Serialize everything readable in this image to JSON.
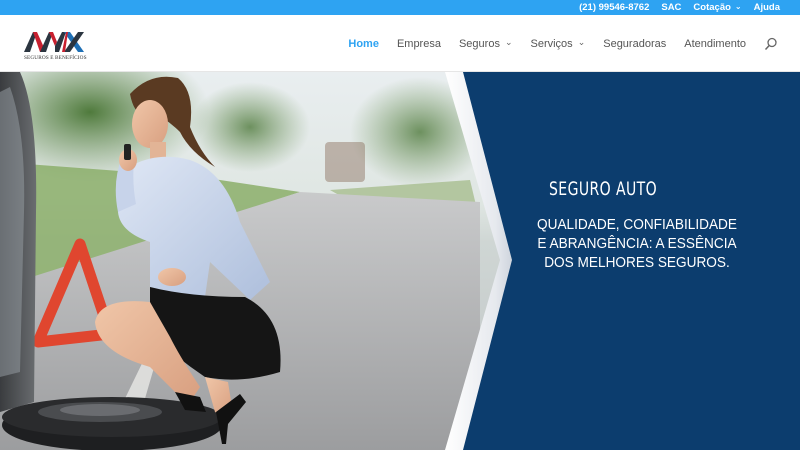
{
  "topbar": {
    "phone": "(21) 99546-8762",
    "sac": "SAC",
    "cotacao": "Cotação",
    "ajuda": "Ajuda"
  },
  "header": {
    "logo_text": "AMX",
    "logo_subtitle": "SEGUROS E BENEFÍCIOS",
    "nav": {
      "home": "Home",
      "empresa": "Empresa",
      "seguros": "Seguros",
      "servicos": "Serviços",
      "seguradoras": "Seguradoras",
      "atendimento": "Atendimento"
    }
  },
  "hero": {
    "title": "SEGURO AUTO",
    "line1": "QUALIDADE, CONFIABILIDADE",
    "line2": "E ABRANGÊNCIA: A ESSÊNCIA",
    "line3": "DOS MELHORES SEGUROS."
  },
  "colors": {
    "topbar": "#2ea3f2",
    "active_nav": "#2ea3f2",
    "panel": "#0c3d6e",
    "logo_red": "#c8202f",
    "logo_dark": "#2b3540",
    "logo_blue": "#1e6fb5"
  },
  "icons": {
    "search": "search-icon",
    "chevron": "chevron-down-icon",
    "warning_triangle": "warning-triangle-icon"
  }
}
